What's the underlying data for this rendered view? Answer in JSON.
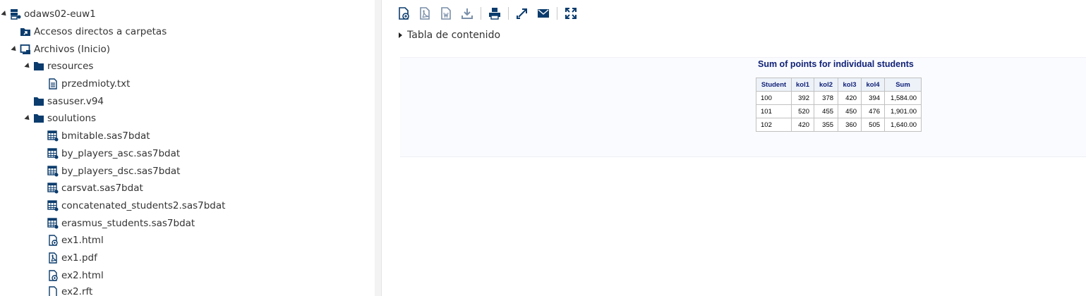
{
  "tree": {
    "items": [
      {
        "label": "odaws02-euw1",
        "icon": "server-icon",
        "expanded": true
      },
      {
        "label": "Accesos directos a carpetas",
        "icon": "folder-shortcut-icon"
      },
      {
        "label": "Archivos (Inicio)",
        "icon": "home-folder-icon",
        "expanded": true
      },
      {
        "label": "resources",
        "icon": "folder-icon",
        "expanded": true
      },
      {
        "label": "przedmioty.txt",
        "icon": "text-file-icon"
      },
      {
        "label": "sasuser.v94",
        "icon": "folder-icon"
      },
      {
        "label": "soulutions",
        "icon": "folder-icon",
        "expanded": true
      },
      {
        "label": "bmitable.sas7bdat",
        "icon": "sas-table-icon"
      },
      {
        "label": "by_players_asc.sas7bdat",
        "icon": "sas-table-icon"
      },
      {
        "label": "by_players_dsc.sas7bdat",
        "icon": "sas-table-icon"
      },
      {
        "label": "carsvat.sas7bdat",
        "icon": "sas-table-icon"
      },
      {
        "label": "concatenated_students2.sas7bdat",
        "icon": "sas-table-icon"
      },
      {
        "label": "erasmus_students.sas7bdat",
        "icon": "sas-table-icon"
      },
      {
        "label": "ex1.html",
        "icon": "html-file-icon"
      },
      {
        "label": "ex1.pdf",
        "icon": "pdf-file-icon"
      },
      {
        "label": "ex2.html",
        "icon": "html-file-icon"
      },
      {
        "label": "ex2.rft",
        "icon": "file-icon"
      }
    ]
  },
  "toolbar": {
    "buttons": [
      {
        "name": "html-download-icon"
      },
      {
        "name": "pdf-download-icon"
      },
      {
        "name": "rtf-download-icon"
      },
      {
        "name": "download-icon"
      },
      {
        "name": "print-icon"
      },
      {
        "name": "open-new-window-icon"
      },
      {
        "name": "email-icon"
      },
      {
        "name": "expand-icon"
      }
    ]
  },
  "toc": {
    "label": "Tabla de contenido"
  },
  "report": {
    "title": "Sum of points for individual students",
    "columns": [
      "Student",
      "kol1",
      "kol2",
      "kol3",
      "kol4",
      "Sum"
    ],
    "rows": [
      [
        "100",
        "392",
        "378",
        "420",
        "394",
        "1,584.00"
      ],
      [
        "101",
        "520",
        "455",
        "450",
        "476",
        "1,901.00"
      ],
      [
        "102",
        "420",
        "355",
        "360",
        "505",
        "1,640.00"
      ]
    ]
  },
  "colors": {
    "icon": "#0b3c6d",
    "title": "#112277",
    "header_bg": "#edf2f9"
  }
}
